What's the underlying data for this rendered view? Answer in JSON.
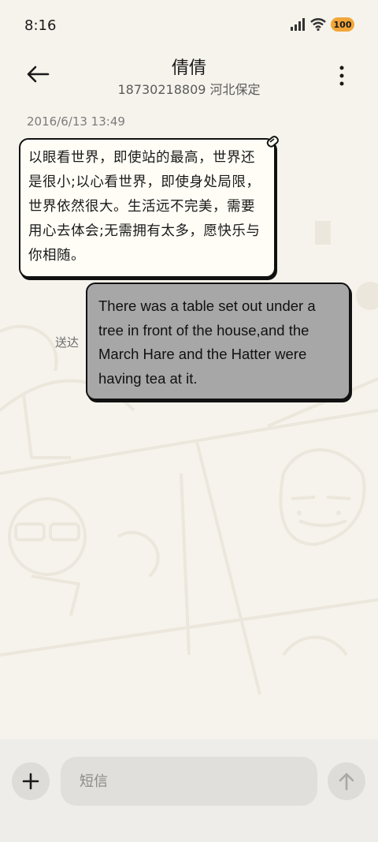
{
  "status_bar": {
    "time": "8:16",
    "battery": "100",
    "icons": [
      "signal-icon",
      "wifi-icon",
      "battery-icon"
    ]
  },
  "header": {
    "contact_name": "倩倩",
    "contact_subtitle": "18730218809 河北保定",
    "icons": [
      "back-arrow-icon",
      "more-vertical-icon"
    ]
  },
  "conversation": {
    "timestamp": "2016/6/13 13:49",
    "incoming_message": "以眼看世界，即使站的最高，世界还是很小;以心看世界，即使身处局限，世界依然很大。生活远不完美，需要用心去体会;无需拥有太多，愿快乐与你相随。",
    "outgoing_message": "There was a table set out under a tree in front of the house,and the March Hare and the Hatter were having tea at it.",
    "outgoing_status": "送达"
  },
  "composer": {
    "placeholder": "短信",
    "value": "",
    "icons": [
      "plus-icon",
      "send-arrow-icon"
    ]
  },
  "colors": {
    "background": "#f6f3ec",
    "incoming_bubble": "#fffdf6",
    "outgoing_bubble": "#a7a7a7",
    "battery": "#f2a638",
    "input_bar": "#eeedea"
  }
}
